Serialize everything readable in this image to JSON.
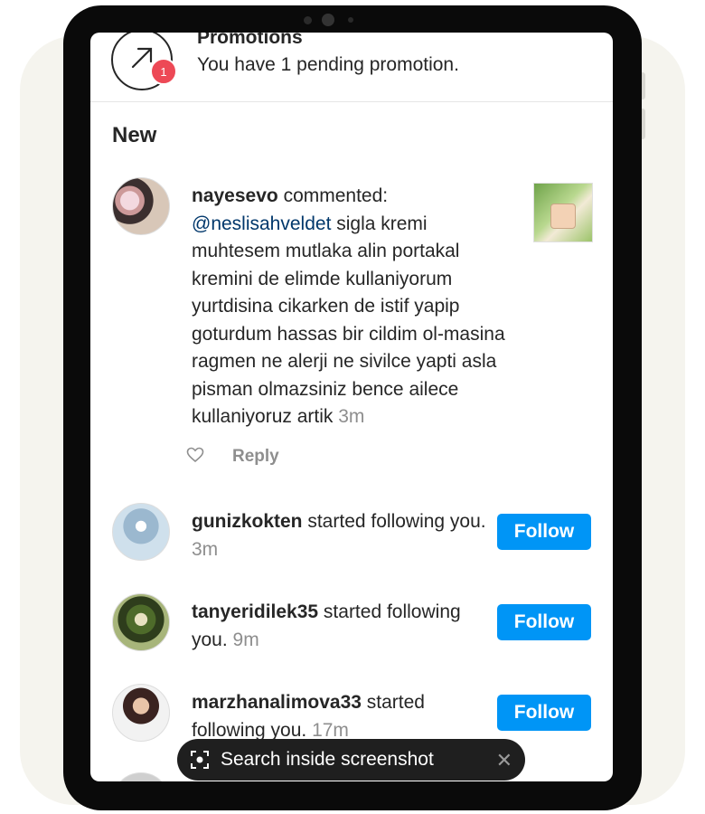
{
  "promotions": {
    "title": "Promotions",
    "subtitle": "You have 1 pending promotion.",
    "badge_count": "1"
  },
  "section": {
    "title": "New"
  },
  "comment": {
    "username": "nayesevo",
    "action": " commented: ",
    "mention": "@neslisahveldet",
    "body": " sigla kremi muhtesem mutlaka alin portakal kremini de elimde kullaniyorum yurtdisina cikarken de istif yapip goturdum hassas bir cildim ol-masina ragmen ne alerji ne sivilce yapti asla pisman olmazsiniz bence ailece kullaniyoruz artik ",
    "time": "3m",
    "reply_label": "Reply"
  },
  "follows": [
    {
      "username": "gunizkokten",
      "action": " started following you. ",
      "time": "3m",
      "button": "Follow"
    },
    {
      "username": "tanyeridilek35",
      "action": " started following you. ",
      "time": "9m",
      "button": "Follow"
    },
    {
      "username": "marzhanalimova33",
      "action": " started following you. ",
      "time": "17m",
      "button": "Follow"
    }
  ],
  "lens": {
    "label": "Search inside screenshot",
    "close": "✕"
  },
  "colors": {
    "follow_button": "#0095f6",
    "badge": "#ed4956",
    "mention": "#00376b",
    "muted": "#8e8e8e"
  }
}
